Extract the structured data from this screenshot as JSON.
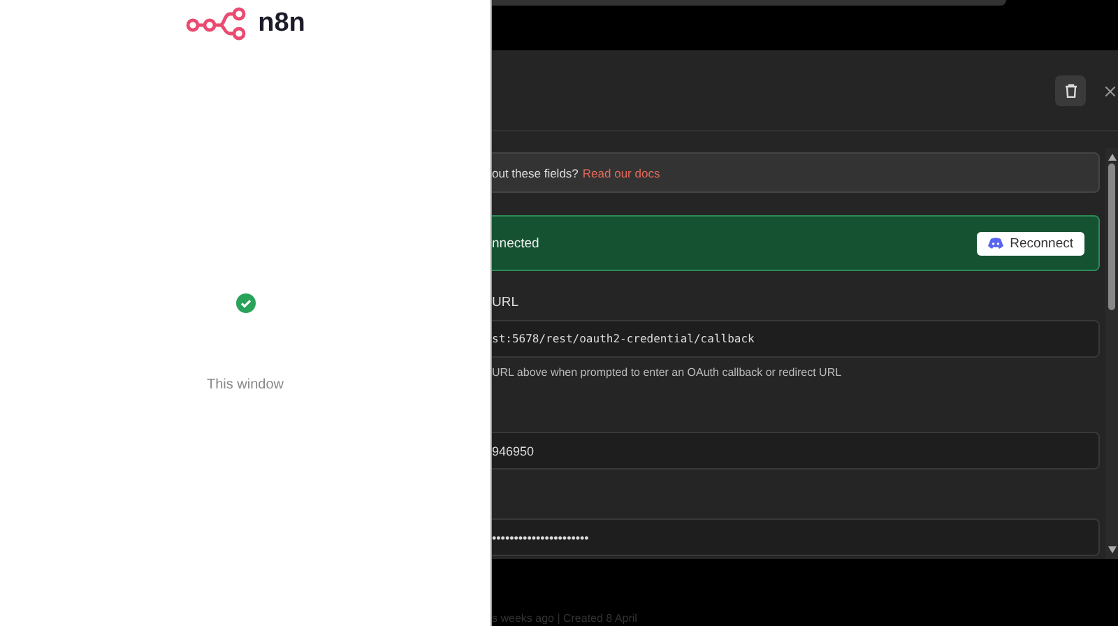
{
  "popup": {
    "logo_text": "n8n",
    "success": true,
    "message": "This window"
  },
  "modal": {
    "info_text": "out these fields?",
    "info_link": "Read our docs",
    "status": {
      "text": "nnected",
      "button": "Reconnect"
    },
    "fields": [
      {
        "label": "URL",
        "value": "st:5678/rest/oauth2-credential/callback",
        "kind": "url",
        "hint": "URL above when prompted to enter an OAuth callback or redirect URL"
      },
      {
        "value": "946950",
        "kind": "text"
      },
      {
        "value": "••••••••••••••••••••••",
        "kind": "text"
      }
    ]
  },
  "footer": "s weeks ago | Created 8 April"
}
